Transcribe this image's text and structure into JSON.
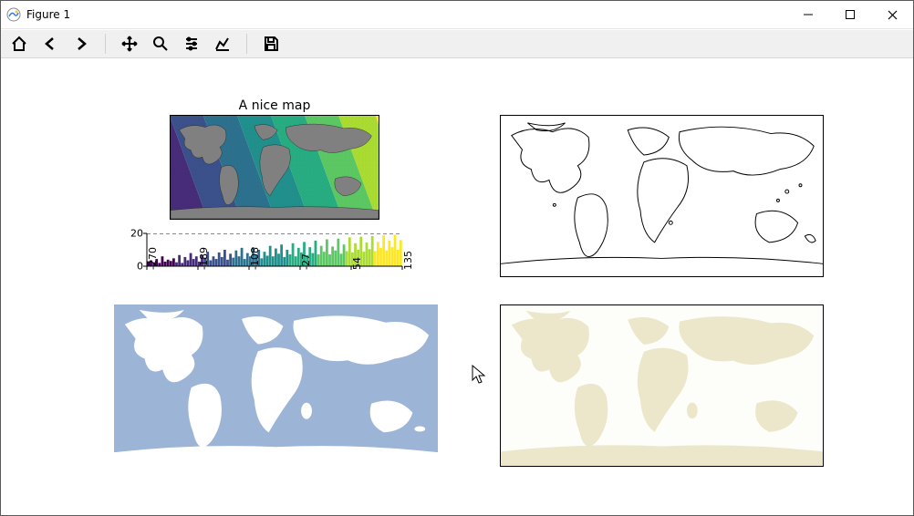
{
  "window": {
    "title": "Figure 1"
  },
  "toolbar": {
    "icons": [
      "home",
      "back",
      "forward",
      "pan",
      "zoom",
      "configure",
      "edit-axes",
      "save"
    ]
  },
  "subplot1": {
    "title": "A nice map",
    "colormap": "viridis",
    "colors": [
      "#440154",
      "#472c7a",
      "#3b518b",
      "#2c718e",
      "#21908d",
      "#27ad81",
      "#5cc863",
      "#aadc32",
      "#fde725"
    ]
  },
  "histogram": {
    "yticks": [
      0,
      20
    ],
    "xticks": [
      -270,
      -189,
      -108,
      -27,
      54,
      135
    ],
    "bars_rel": [
      0.15,
      0.18,
      0.12,
      0.22,
      0.1,
      0.3,
      0.14,
      0.2,
      0.16,
      0.24,
      0.12,
      0.34,
      0.1,
      0.28,
      0.18,
      0.4,
      0.22,
      0.3,
      0.14,
      0.34,
      0.26,
      0.44,
      0.18,
      0.3,
      0.22,
      0.42,
      0.28,
      0.5,
      0.2,
      0.38,
      0.26,
      0.48,
      0.3,
      0.56,
      0.22,
      0.4,
      0.3,
      0.58,
      0.34,
      0.5,
      0.24,
      0.44,
      0.32,
      0.62,
      0.3,
      0.54,
      0.38,
      0.66,
      0.28,
      0.5,
      0.36,
      0.7,
      0.3,
      0.56,
      0.42,
      0.74,
      0.34,
      0.58,
      0.4,
      0.78,
      0.36,
      0.62,
      0.44,
      0.82,
      0.36,
      0.6,
      0.48,
      0.84,
      0.38,
      0.66,
      0.46,
      0.88,
      0.42,
      0.7,
      0.5,
      0.9,
      0.44,
      0.72,
      0.52,
      0.92,
      0.46,
      0.74,
      0.56,
      0.94,
      0.48,
      0.78,
      0.58,
      0.96,
      0.5,
      0.8
    ]
  },
  "chart_data": {
    "type": "bar",
    "title": "A nice map",
    "xlabel": "",
    "ylabel": "",
    "xlim": [
      -270,
      135
    ],
    "ylim": [
      0,
      20
    ],
    "xticks": [
      -270,
      -189,
      -108,
      -27,
      54,
      135
    ],
    "yticks": [
      0,
      20
    ],
    "note": "Histogram under the 'A nice map' colored world plot showing distribution of mapped values over the viridis colormap.",
    "colormap": "viridis"
  },
  "subplot2": {
    "style": "coastlines-black-on-white"
  },
  "subplot3": {
    "ocean_color": "#9cb5d6",
    "land_color": "#ffffff"
  },
  "subplot4": {
    "bg_color": "#fdfdf9",
    "land_color": "#ece7ca"
  },
  "meta": {
    "description": "Matplotlib figure window containing 4 world-map subplots: (top-left) filled world map with viridis color bands and title 'A nice map' plus a small histogram colorbar below it; (top-right) black coastlines outline map on white; (bottom-left) blue-ocean / white-land world map; (bottom-right) pale beige land on off-white world map."
  }
}
